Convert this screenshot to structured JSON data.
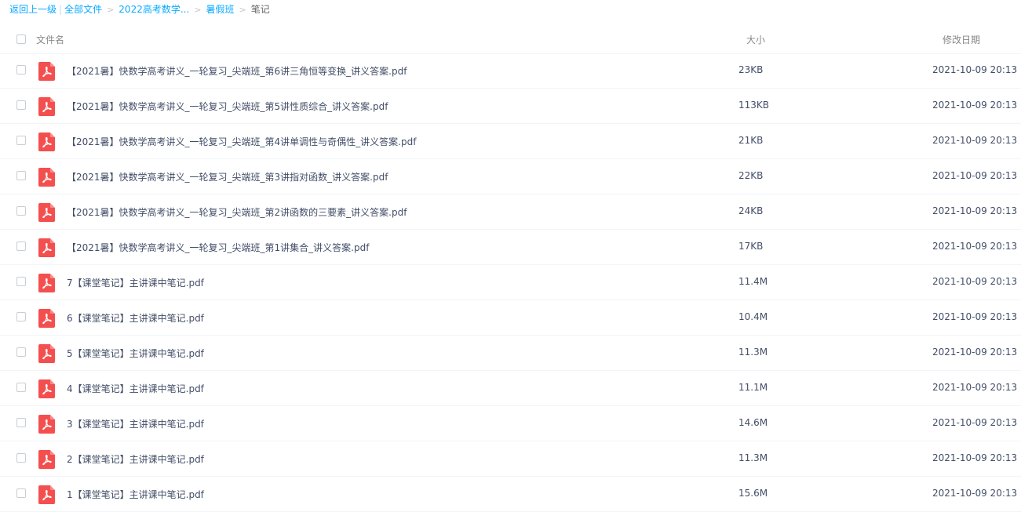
{
  "breadcrumb": {
    "back": "返回上一级",
    "all_files": "全部文件",
    "folder1": "2022高考数学...",
    "folder2": "暑假班",
    "current": "笔记"
  },
  "header": {
    "name": "文件名",
    "size": "大小",
    "date": "修改日期"
  },
  "files": [
    {
      "name": "【2021暑】快数学高考讲义_一轮复习_尖端班_第6讲三角恒等变换_讲义答案.pdf",
      "size": "23KB",
      "date": "2021-10-09 20:13"
    },
    {
      "name": "【2021暑】快数学高考讲义_一轮复习_尖端班_第5讲性质综合_讲义答案.pdf",
      "size": "113KB",
      "date": "2021-10-09 20:13"
    },
    {
      "name": "【2021暑】快数学高考讲义_一轮复习_尖端班_第4讲单调性与奇偶性_讲义答案.pdf",
      "size": "21KB",
      "date": "2021-10-09 20:13"
    },
    {
      "name": "【2021暑】快数学高考讲义_一轮复习_尖端班_第3讲指对函数_讲义答案.pdf",
      "size": "22KB",
      "date": "2021-10-09 20:13"
    },
    {
      "name": "【2021暑】快数学高考讲义_一轮复习_尖端班_第2讲函数的三要素_讲义答案.pdf",
      "size": "24KB",
      "date": "2021-10-09 20:13"
    },
    {
      "name": "【2021暑】快数学高考讲义_一轮复习_尖端班_第1讲集合_讲义答案.pdf",
      "size": "17KB",
      "date": "2021-10-09 20:13"
    },
    {
      "name": "7【课堂笔记】主讲课中笔记.pdf",
      "size": "11.4M",
      "date": "2021-10-09 20:13"
    },
    {
      "name": "6【课堂笔记】主讲课中笔记.pdf",
      "size": "10.4M",
      "date": "2021-10-09 20:13"
    },
    {
      "name": "5【课堂笔记】主讲课中笔记.pdf",
      "size": "11.3M",
      "date": "2021-10-09 20:13"
    },
    {
      "name": "4【课堂笔记】主讲课中笔记.pdf",
      "size": "11.1M",
      "date": "2021-10-09 20:13"
    },
    {
      "name": "3【课堂笔记】主讲课中笔记.pdf",
      "size": "14.6M",
      "date": "2021-10-09 20:13"
    },
    {
      "name": "2【课堂笔记】主讲课中笔记.pdf",
      "size": "11.3M",
      "date": "2021-10-09 20:13"
    },
    {
      "name": "1【课堂笔记】主讲课中笔记.pdf",
      "size": "15.6M",
      "date": "2021-10-09 20:13"
    }
  ],
  "file_icon": "pdf-icon",
  "colors": {
    "link": "#09aaff",
    "pdf_icon": "#f44f4f",
    "text": "#424e67",
    "header_text": "#888888"
  }
}
